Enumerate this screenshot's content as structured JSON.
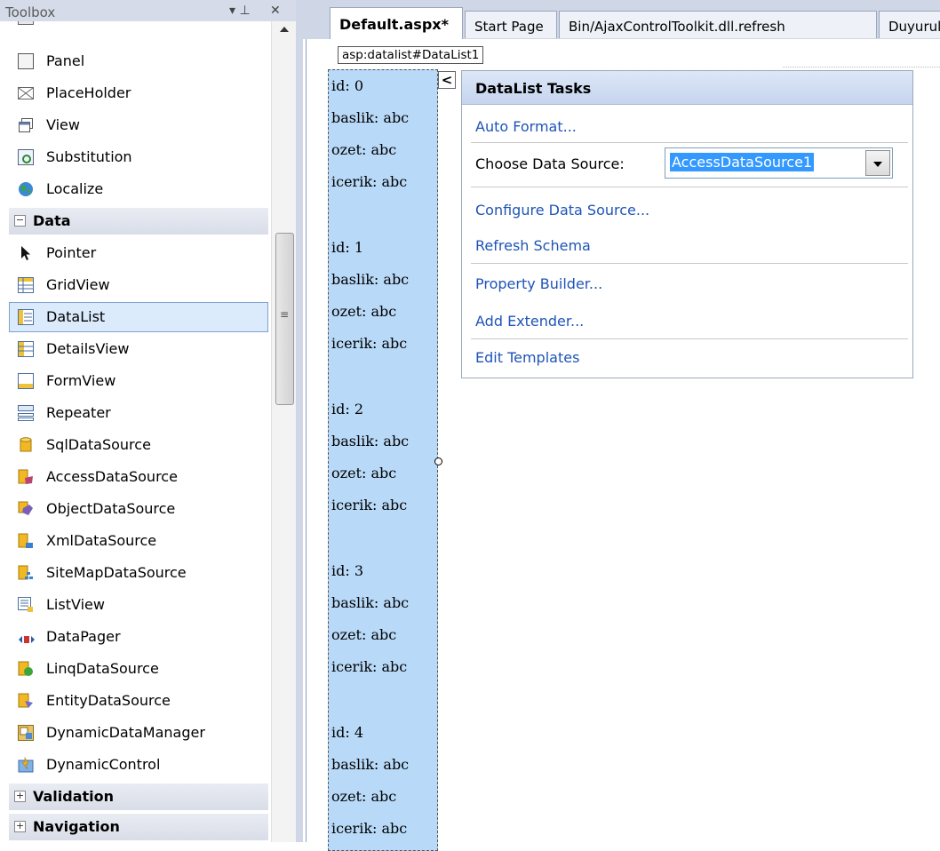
{
  "toolbox": {
    "title": "Toolbox",
    "pin_glyph": "▾ ⊥",
    "close_glyph": "✕",
    "items_top": [
      "Panel",
      "PlaceHolder",
      "View",
      "Substitution",
      "Localize"
    ],
    "category_data": "Data",
    "data_items": [
      "Pointer",
      "GridView",
      "DataList",
      "DetailsView",
      "FormView",
      "Repeater",
      "SqlDataSource",
      "AccessDataSource",
      "ObjectDataSource",
      "XmlDataSource",
      "SiteMapDataSource",
      "ListView",
      "DataPager",
      "LinqDataSource",
      "EntityDataSource",
      "DynamicDataManager",
      "DynamicControl"
    ],
    "selected_item": "DataList",
    "category_validation": "Validation",
    "category_navigation": "Navigation"
  },
  "tabs": [
    "Default.aspx*",
    "Start Page",
    "Bin/AjaxControlToolkit.dll.refresh",
    "Duyurular"
  ],
  "designer": {
    "tag_label": "asp:datalist#DataList1",
    "items": [
      {
        "id": "id: 0",
        "baslik": "baslik: abc",
        "ozet": "ozet: abc",
        "icerik": "icerik: abc"
      },
      {
        "id": "id: 1",
        "baslik": "baslik: abc",
        "ozet": "ozet: abc",
        "icerik": "icerik: abc"
      },
      {
        "id": "id: 2",
        "baslik": "baslik: abc",
        "ozet": "ozet: abc",
        "icerik": "icerik: abc"
      },
      {
        "id": "id: 3",
        "baslik": "baslik: abc",
        "ozet": "ozet: abc",
        "icerik": "icerik: abc"
      },
      {
        "id": "id: 4",
        "baslik": "baslik: abc",
        "ozet": "ozet: abc",
        "icerik": "icerik: abc"
      }
    ]
  },
  "smart_panel": {
    "title": "DataList Tasks",
    "auto_format": "Auto Format...",
    "choose_ds_label": "Choose Data Source:",
    "choose_ds_value": "AccessDataSource1",
    "configure": "Configure Data Source...",
    "refresh": "Refresh Schema",
    "property_builder": "Property Builder...",
    "add_extender": "Add Extender...",
    "edit_templates": "Edit Templates",
    "collapse_glyph": "<"
  },
  "colors": {
    "link": "#1e54b8",
    "datalist_bg": "#b8d9f8",
    "selection": "#3399ff"
  }
}
